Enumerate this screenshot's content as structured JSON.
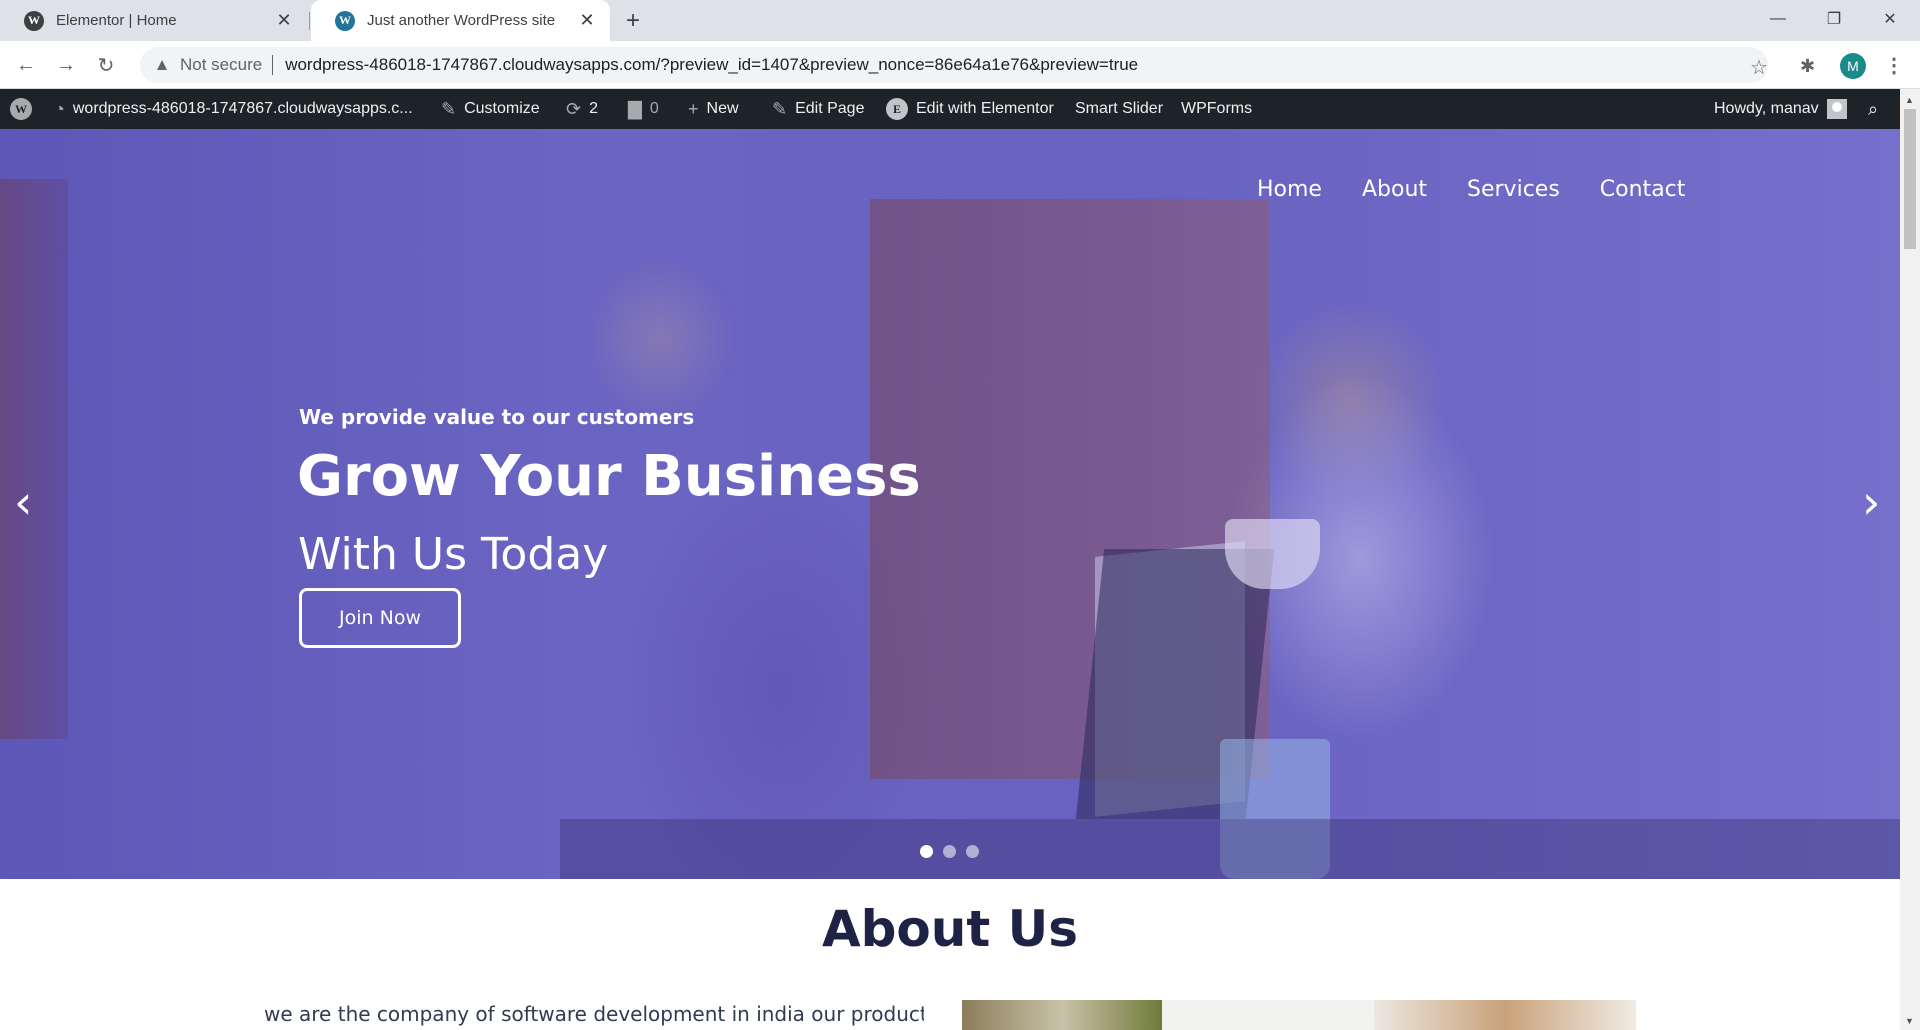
{
  "browser": {
    "tabs": [
      {
        "title": "Elementor | Home",
        "favicon": "wordpress-icon"
      },
      {
        "title": "Just another WordPress site",
        "favicon": "wordpress-icon"
      }
    ],
    "security_label": "Not secure",
    "url": "wordpress-486018-1747867.cloudwaysapps.com/?preview_id=1407&preview_nonce=86e64a1e76&preview=true",
    "profile_initial": "M",
    "accent": "#1a8a8a"
  },
  "admin_bar": {
    "site_name": "wordpress-486018-1747867.cloudwaysapps.c...",
    "customize": "Customize",
    "updates_count": "2",
    "comments_count": "0",
    "new": "New",
    "edit_page": "Edit Page",
    "edit_elementor": "Edit with Elementor",
    "smart_slider": "Smart Slider",
    "wpforms": "WPForms",
    "howdy": "Howdy, manav"
  },
  "site_nav": [
    "Home",
    "About",
    "Services",
    "Contact"
  ],
  "hero": {
    "subtitle": "We provide value to our customers",
    "title": "Grow Your Business",
    "title_line2": "With Us Today",
    "button": "Join Now",
    "slide_count": 3,
    "active_slide": 1,
    "overlay_color": "#6560c0"
  },
  "about": {
    "title": "About Us",
    "text": "we are the company of software development in india our product or"
  }
}
